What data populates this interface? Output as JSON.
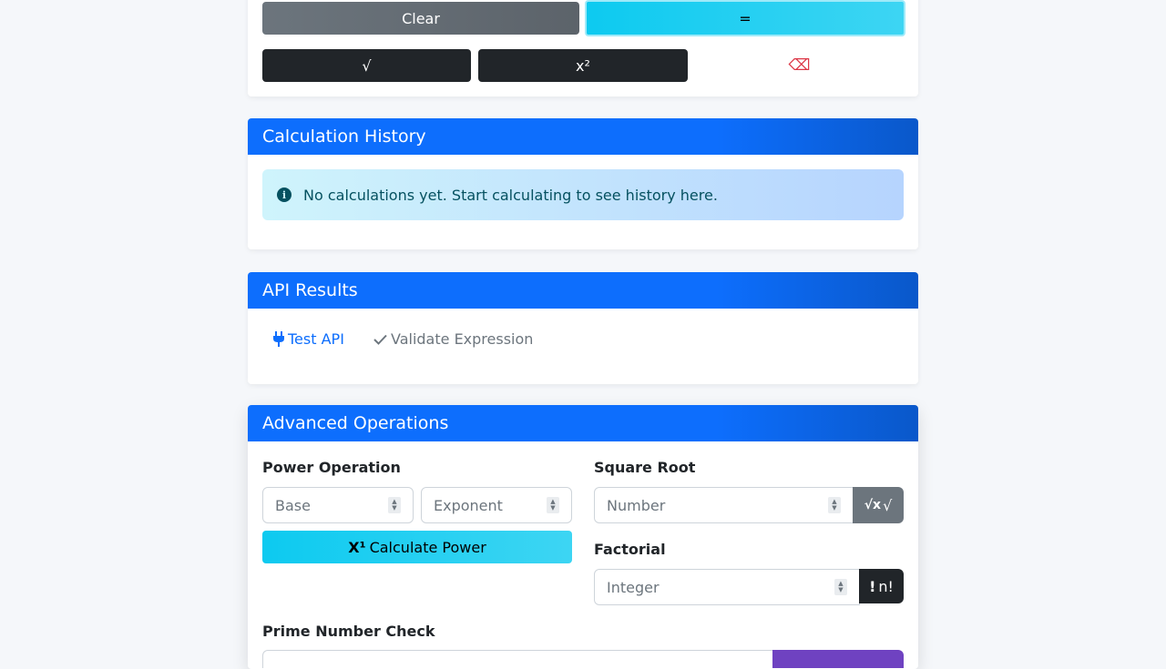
{
  "calculator": {
    "clear_label": "Clear",
    "equals_label": "=",
    "sqrt_label": "√",
    "square_label": "x²",
    "backspace_label": "⌫"
  },
  "history": {
    "title": "Calculation History",
    "empty_message": "No calculations yet. Start calculating to see history here."
  },
  "api": {
    "title": "API Results",
    "test_label": "Test API",
    "validate_label": "Validate Expression"
  },
  "advanced": {
    "title": "Advanced Operations",
    "power": {
      "label": "Power Operation",
      "base_placeholder": "Base",
      "exponent_placeholder": "Exponent",
      "button_label": "Calculate Power",
      "button_icon_text": "X¹"
    },
    "sqrt": {
      "label": "Square Root",
      "placeholder": "Number",
      "button_icon_text": "√x",
      "button_label": "√"
    },
    "factorial": {
      "label": "Factorial",
      "placeholder": "Integer",
      "button_icon_text": "!",
      "button_label": "n!"
    },
    "prime": {
      "label": "Prime Number Check"
    }
  },
  "colors": {
    "primary": "#0d6efd",
    "info": "#0dcaf0",
    "secondary": "#6c757d",
    "dark": "#212529",
    "danger": "#dc3545",
    "purple": "#6f42c1"
  }
}
